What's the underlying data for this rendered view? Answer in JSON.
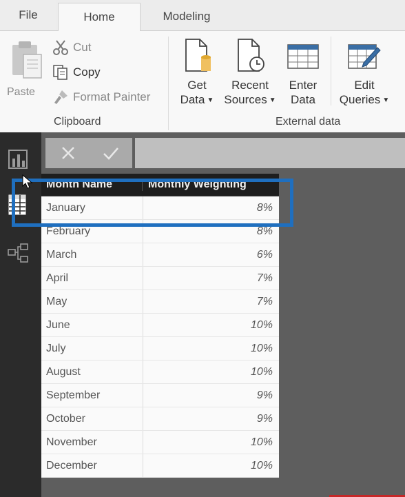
{
  "tabs": {
    "file": "File",
    "home": "Home",
    "modeling": "Modeling"
  },
  "clipboard": {
    "paste": "Paste",
    "cut": "Cut",
    "copy": "Copy",
    "format_painter": "Format Painter",
    "group_label": "Clipboard"
  },
  "external_data": {
    "get_data": {
      "line1": "Get",
      "line2": "Data"
    },
    "recent_sources": {
      "line1": "Recent",
      "line2": "Sources"
    },
    "enter_data": {
      "line1": "Enter",
      "line2": "Data"
    },
    "edit_queries": {
      "line1": "Edit",
      "line2": "Queries"
    },
    "group_label": "External data"
  },
  "table": {
    "headers": [
      "Month Name",
      "Monthly Weighting"
    ],
    "rows": [
      [
        "January",
        "8%"
      ],
      [
        "February",
        "8%"
      ],
      [
        "March",
        "6%"
      ],
      [
        "April",
        "7%"
      ],
      [
        "May",
        "7%"
      ],
      [
        "June",
        "10%"
      ],
      [
        "July",
        "10%"
      ],
      [
        "August",
        "10%"
      ],
      [
        "September",
        "9%"
      ],
      [
        "October",
        "9%"
      ],
      [
        "November",
        "10%"
      ],
      [
        "December",
        "10%"
      ]
    ]
  },
  "colors": {
    "highlight": "#1f6fbf",
    "rail": "#2b2b2b",
    "canvas": "#5e5e5e"
  }
}
